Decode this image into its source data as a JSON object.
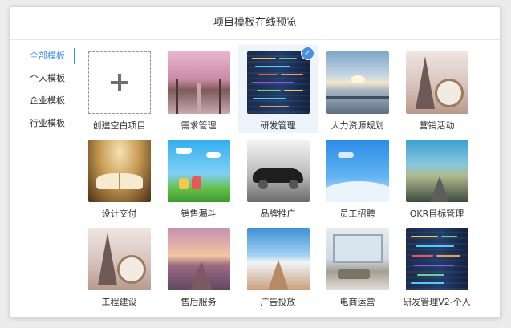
{
  "dialog": {
    "title": "项目模板在线预览"
  },
  "sidebar": {
    "items": [
      {
        "label": "全部模板",
        "active": true
      },
      {
        "label": "个人模板",
        "active": false
      },
      {
        "label": "企业模板",
        "active": false
      },
      {
        "label": "行业模板",
        "active": false
      }
    ]
  },
  "templates": [
    {
      "label": "创建空白项目",
      "icon": "plus-icon"
    },
    {
      "label": "需求管理"
    },
    {
      "label": "研发管理",
      "selected": true,
      "icon": "checkmark-icon"
    },
    {
      "label": "人力资源规划"
    },
    {
      "label": "营销活动"
    },
    {
      "label": "设计交付"
    },
    {
      "label": "销售漏斗"
    },
    {
      "label": "品牌推广"
    },
    {
      "label": "员工招聘"
    },
    {
      "label": "OKR目标管理"
    },
    {
      "label": "工程建设"
    },
    {
      "label": "售后服务"
    },
    {
      "label": "广告投放"
    },
    {
      "label": "电商运营"
    },
    {
      "label": "研发管理V2-个人"
    }
  ],
  "colors": {
    "accent": "#3b8ef0",
    "selected_bg": "#edf4fc"
  }
}
